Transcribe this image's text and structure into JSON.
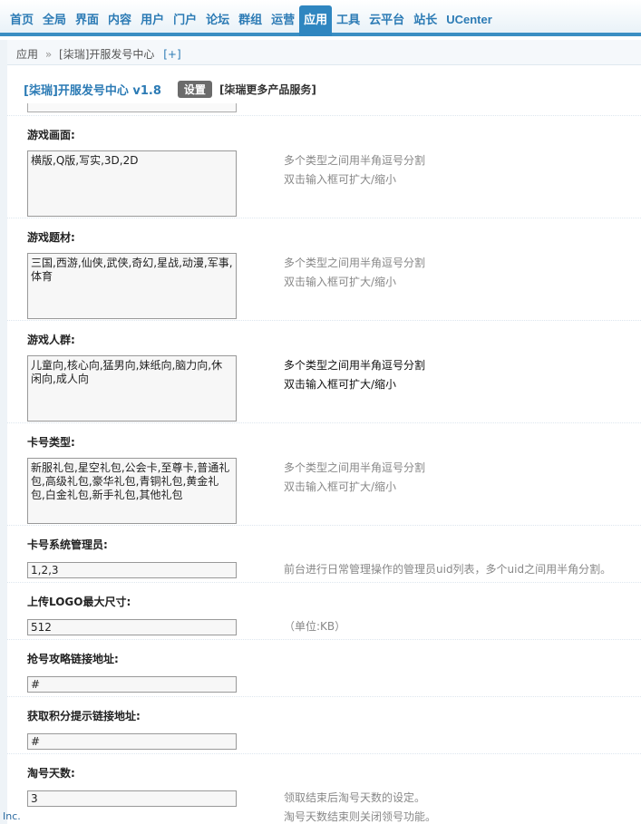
{
  "nav": {
    "tabs": [
      "首页",
      "全局",
      "界面",
      "内容",
      "用户",
      "门户",
      "论坛",
      "群组",
      "运营",
      "应用",
      "工具",
      "云平台",
      "站长",
      "UCenter"
    ],
    "active": "应用"
  },
  "breadcrumb": {
    "root": "应用",
    "separator": "»",
    "current": "[柒瑞]开服发号中心",
    "plus": "[+]"
  },
  "plugin": {
    "title": "[柒瑞]开服发号中心 v1.8",
    "settings": "设置",
    "more": "[柒瑞更多产品服务]"
  },
  "fields": {
    "screen": {
      "label": "游戏画面:",
      "value": "横版,Q版,写实,3D,2D",
      "tip1": "多个类型之间用半角逗号分割",
      "tip2": "双击输入框可扩大/缩小"
    },
    "theme": {
      "label": "游戏题材:",
      "value": "三国,西游,仙侠,武侠,奇幻,星战,动漫,军事,体育",
      "tip1": "多个类型之间用半角逗号分割",
      "tip2": "双击输入框可扩大/缩小"
    },
    "audience": {
      "label": "游戏人群:",
      "value": "儿童向,核心向,猛男向,妹纸向,脑力向,休闲向,成人向",
      "tip1": "多个类型之间用半角逗号分割",
      "tip2": "双击输入框可扩大/缩小"
    },
    "cardtype": {
      "label": "卡号类型:",
      "value": "新服礼包,星空礼包,公会卡,至尊卡,普通礼包,高级礼包,豪华礼包,青铜礼包,黄金礼包,白金礼包,新手礼包,其他礼包",
      "tip1": "多个类型之间用半角逗号分割",
      "tip2": "双击输入框可扩大/缩小"
    },
    "admins": {
      "label": "卡号系统管理员:",
      "value": "1,2,3",
      "tip1": "前台进行日常管理操作的管理员uid列表，多个uid之间用半角分割。"
    },
    "logo": {
      "label": "上传LOGO最大尺寸:",
      "value": "512",
      "tip1": "（单位:KB）"
    },
    "guide": {
      "label": "抢号攻略链接地址:",
      "value": "#"
    },
    "points": {
      "label": "获取积分提示链接地址:",
      "value": "#"
    },
    "tao": {
      "label": "淘号天数:",
      "value": "3",
      "tip1": "领取结束后淘号天数的设定。",
      "tip2": "淘号天数结束则关闭领号功能。"
    }
  },
  "footer": {
    "inc": "Inc."
  }
}
